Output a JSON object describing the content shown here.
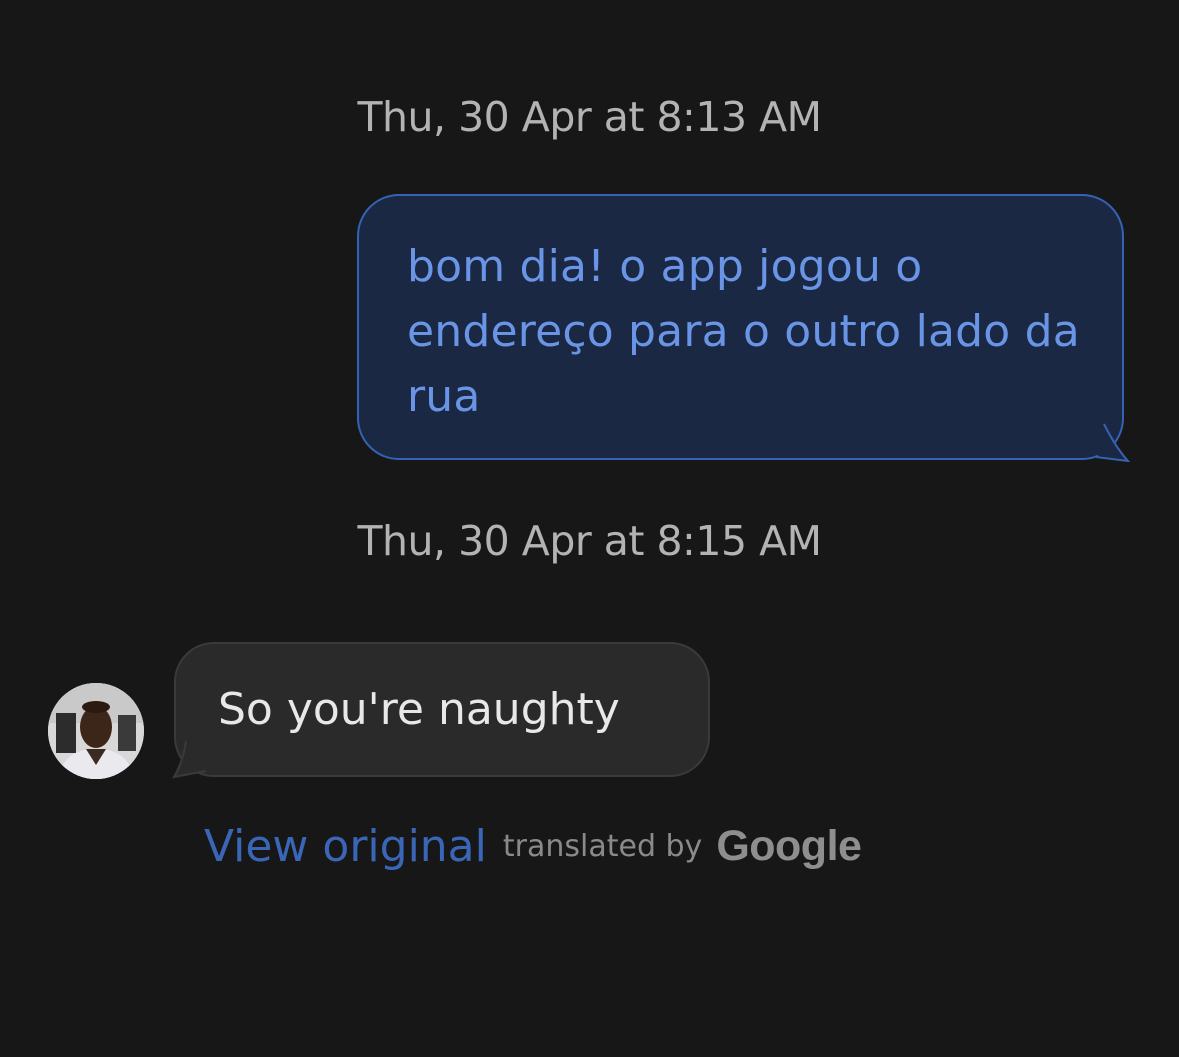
{
  "timestamps": [
    "Thu, 30 Apr at 8:13 AM",
    "Thu, 30 Apr at 8:15 AM"
  ],
  "messages": [
    {
      "direction": "outgoing",
      "text": "bom dia! o app jogou o endereço para o outro lado da rua"
    },
    {
      "direction": "incoming",
      "text": "So you're naughty"
    }
  ],
  "translation": {
    "link_label": "View original",
    "translated_by": "translated by",
    "provider": "Google"
  },
  "colors": {
    "background": "#171717",
    "outgoing_bubble": "#1a2844",
    "outgoing_border": "#3562b4",
    "outgoing_text": "#6a95e6",
    "incoming_bubble": "#2a2a2a",
    "link": "#3a66b8"
  }
}
